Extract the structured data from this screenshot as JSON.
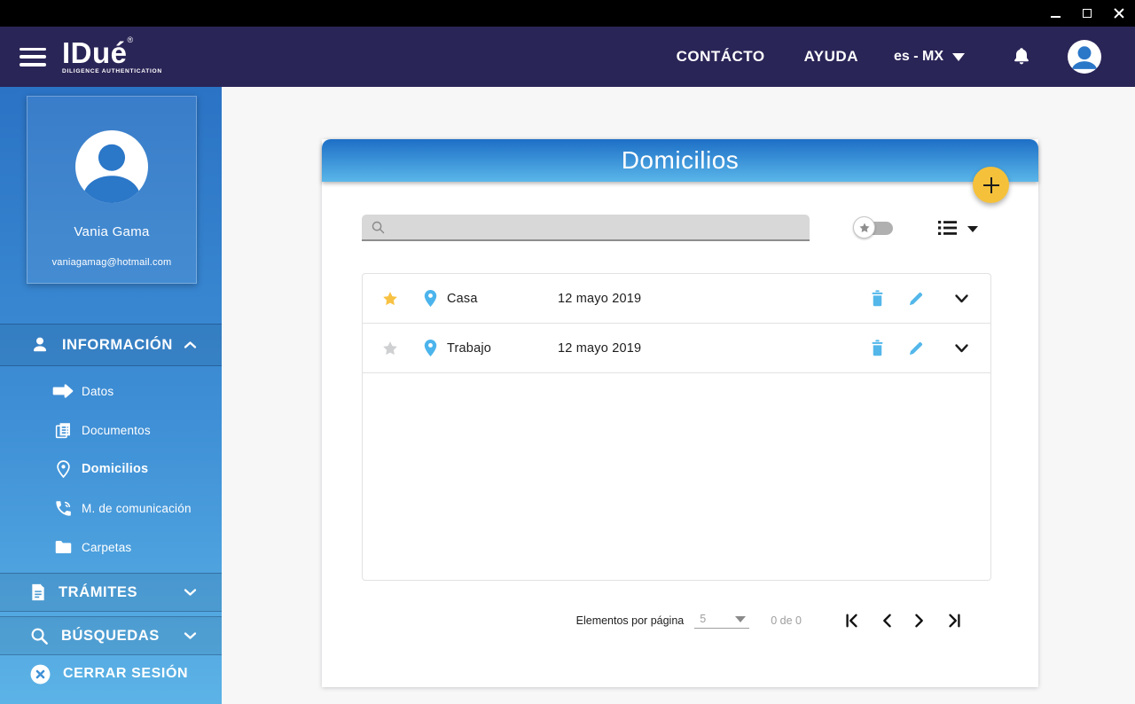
{
  "titlebar": {
    "minimize": "minimize",
    "maximize": "maximize",
    "close": "close"
  },
  "appbar": {
    "logo": {
      "name": "IDué",
      "registered": "®",
      "tagline": "DILIGENCE AUTHENTICATION"
    },
    "contact_label": "CONTÁCTO",
    "help_label": "AYUDA",
    "language": {
      "selected": "es - MX"
    }
  },
  "sidebar": {
    "profile": {
      "name": "Vania Gama",
      "email": "vaniagamag@hotmail.com"
    },
    "information": {
      "label": "INFORMACIÓN",
      "expanded": true
    },
    "info_items": [
      {
        "label": "Datos",
        "active": false
      },
      {
        "label": "Documentos",
        "active": false
      },
      {
        "label": "Domicilios",
        "active": true
      },
      {
        "label": "M. de comunicación",
        "active": false
      },
      {
        "label": "Carpetas",
        "active": false
      }
    ],
    "tramites": {
      "label": "TRÁMITES",
      "expanded": false
    },
    "busquedas": {
      "label": "BÚSQUEDAS",
      "expanded": false
    },
    "logout": {
      "label": "CERRAR SESIÓN"
    }
  },
  "main": {
    "title": "Domicilios",
    "search": {
      "value": "",
      "placeholder": ""
    },
    "rows": [
      {
        "name": "Casa",
        "date": "12 mayo 2019",
        "favorite": true
      },
      {
        "name": "Trabajo",
        "date": "12 mayo 2019",
        "favorite": false
      }
    ],
    "pagination": {
      "items_per_page_label": "Elementos por página",
      "page_size": "5",
      "range": "0 de 0"
    }
  },
  "colors": {
    "header_navy": "#2a2557",
    "sidebar_blue_top": "#2b73c5",
    "sidebar_blue_bottom": "#5cb3e6",
    "band_blue_top": "#1d6fc6",
    "band_blue_bottom": "#5ab6e9",
    "fab_yellow": "#f6c13a",
    "star_yellow": "#f7c244",
    "star_gray": "#cfd0d2",
    "action_blue": "#53b7ea",
    "pin_blue": "#4cb4ec"
  }
}
